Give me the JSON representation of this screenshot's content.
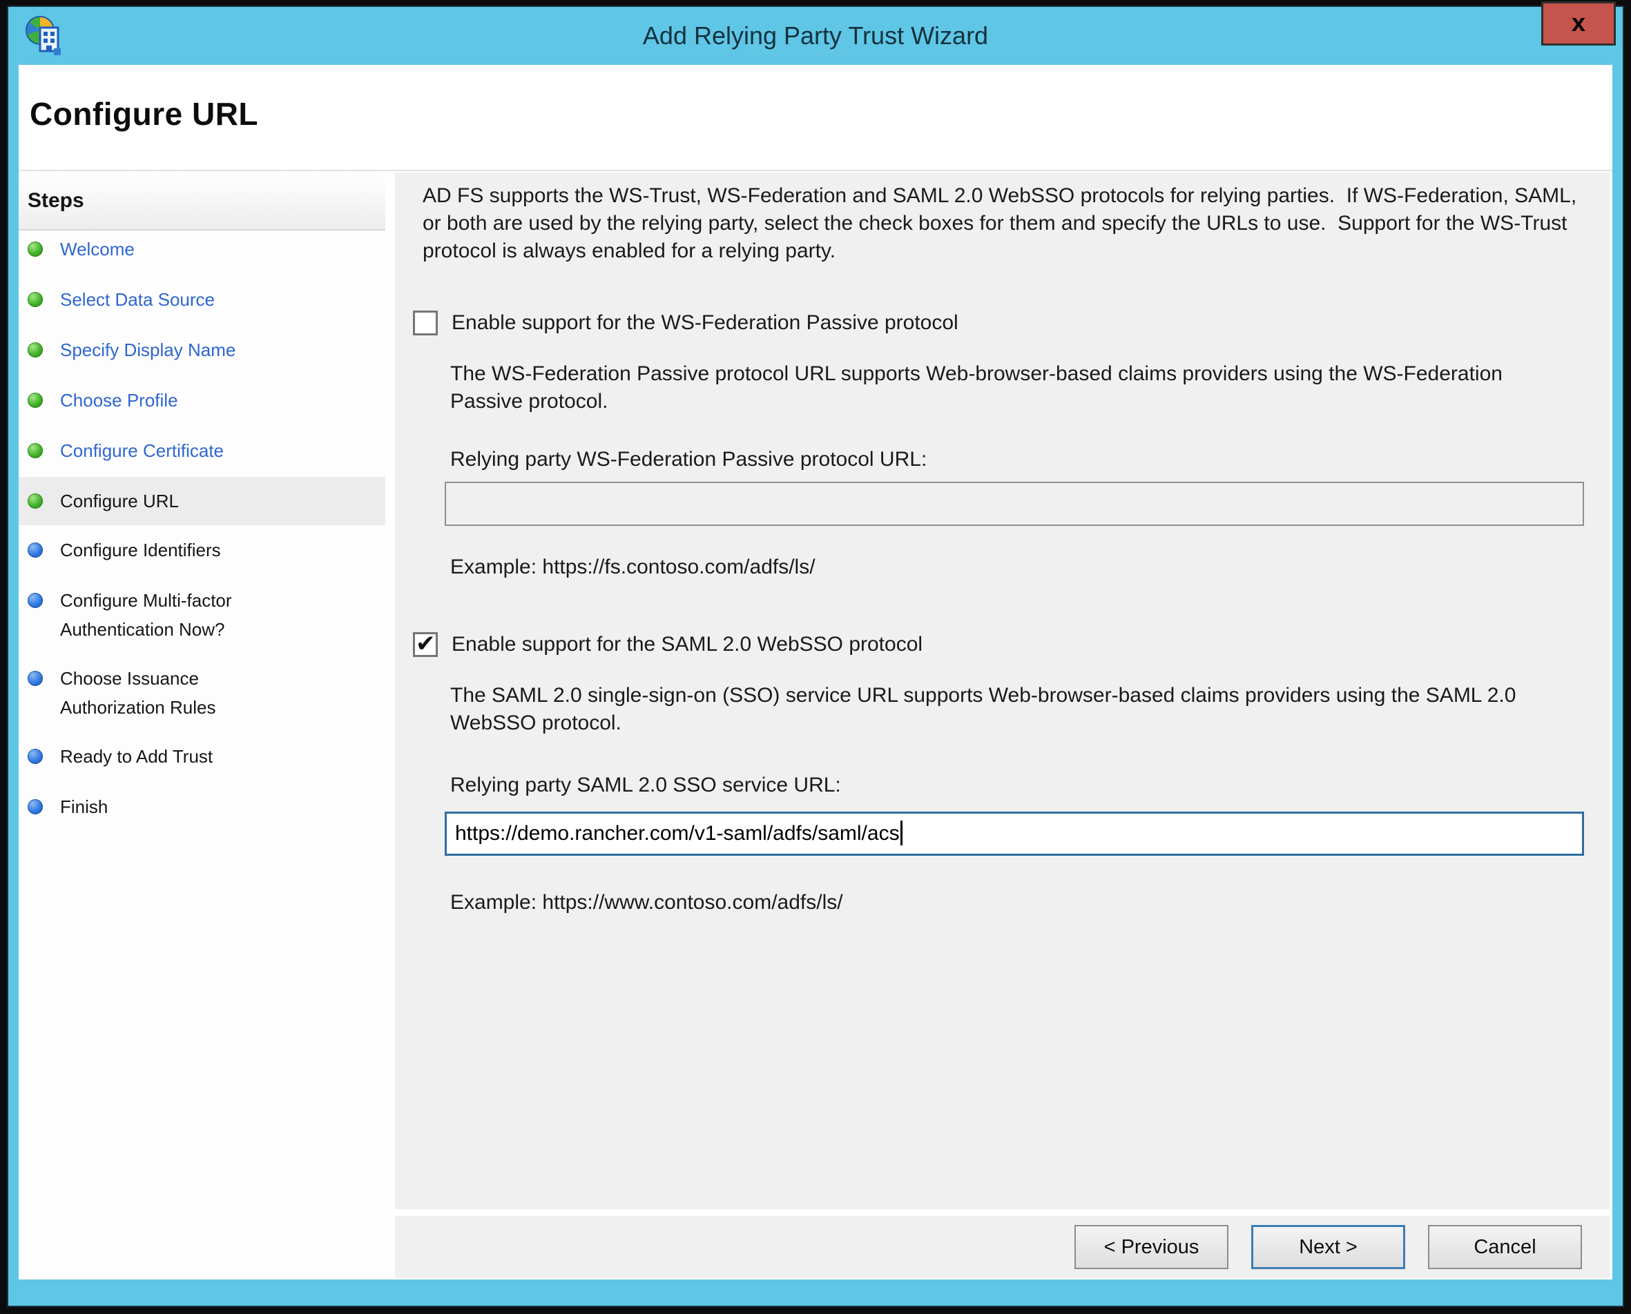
{
  "window": {
    "title": "Add Relying Party Trust Wizard",
    "close_label": "x",
    "icon": "adfs-globe-building-icon"
  },
  "page": {
    "heading": "Configure URL"
  },
  "steps": {
    "header": "Steps",
    "items": [
      {
        "label": "Welcome",
        "state": "done"
      },
      {
        "label": "Select Data Source",
        "state": "done"
      },
      {
        "label": "Specify Display Name",
        "state": "done"
      },
      {
        "label": "Choose Profile",
        "state": "done"
      },
      {
        "label": "Configure Certificate",
        "state": "done"
      },
      {
        "label": "Configure URL",
        "state": "current"
      },
      {
        "label": "Configure Identifiers",
        "state": "upcoming"
      },
      {
        "label": "Configure Multi-factor Authentication Now?",
        "state": "upcoming"
      },
      {
        "label": "Choose Issuance Authorization Rules",
        "state": "upcoming"
      },
      {
        "label": "Ready to Add Trust",
        "state": "upcoming"
      },
      {
        "label": "Finish",
        "state": "upcoming"
      }
    ]
  },
  "content": {
    "intro": "AD FS supports the WS-Trust, WS-Federation and SAML 2.0 WebSSO protocols for relying parties.  If WS-Federation, SAML, or both are used by the relying party, select the check boxes for them and specify the URLs to use.  Support for the WS-Trust protocol is always enabled for a relying party.",
    "wsfed": {
      "checkbox_label": "Enable support for the WS-Federation Passive protocol",
      "checked": false,
      "description": "The WS-Federation Passive protocol URL supports Web-browser-based claims providers using the WS-Federation Passive protocol.",
      "url_label": "Relying party WS-Federation Passive protocol URL:",
      "url_value": "",
      "example": "Example: https://fs.contoso.com/adfs/ls/"
    },
    "saml": {
      "checkbox_label": "Enable support for the SAML 2.0 WebSSO protocol",
      "checked": true,
      "description": "The SAML 2.0 single-sign-on (SSO) service URL supports Web-browser-based claims providers using the SAML 2.0 WebSSO protocol.",
      "url_label": "Relying party SAML 2.0 SSO service URL:",
      "url_value": "https://demo.rancher.com/v1-saml/adfs/saml/acs",
      "example": "Example: https://www.contoso.com/adfs/ls/"
    }
  },
  "footer": {
    "previous_label": "< Previous",
    "next_label": "Next >",
    "cancel_label": "Cancel"
  },
  "colors": {
    "titlebar": "#5fc6e6",
    "close_button": "#c4544c",
    "content_bg": "#f0f0f0",
    "step_done_bullet": "#3fb028",
    "step_upcoming_bullet": "#2e78e0",
    "step_link_text": "#2f66d0",
    "active_input_border": "#2e6da4",
    "default_button_border": "#3d7db5"
  }
}
